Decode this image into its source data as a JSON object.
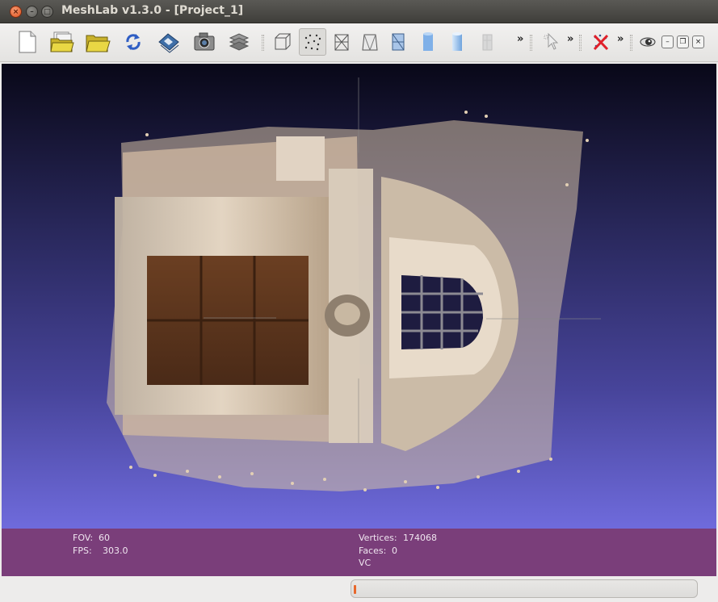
{
  "window": {
    "title": "MeshLab v1.3.0 - [Project_1]"
  },
  "window_controls": {
    "close": "×",
    "minimize": "–",
    "maximize": "□"
  },
  "toolbar": {
    "buttons": [
      {
        "name": "new-project",
        "icon": "new-file-icon"
      },
      {
        "name": "open-project",
        "icon": "open-stack-icon"
      },
      {
        "name": "import-mesh",
        "icon": "open-folder-icon"
      },
      {
        "name": "reload",
        "icon": "reload-icon"
      },
      {
        "name": "save",
        "icon": "save-icon"
      },
      {
        "name": "snapshot",
        "icon": "camera-icon"
      },
      {
        "name": "layers",
        "icon": "layers-icon"
      },
      {
        "name": "bounding-box",
        "icon": "bbox-icon"
      },
      {
        "name": "points",
        "icon": "points-icon",
        "active": true
      },
      {
        "name": "wireframe",
        "icon": "wireframe-icon"
      },
      {
        "name": "hidden-lines",
        "icon": "hidden-lines-icon"
      },
      {
        "name": "flat-lines",
        "icon": "flat-lines-icon"
      },
      {
        "name": "flat",
        "icon": "flat-icon"
      },
      {
        "name": "smooth",
        "icon": "smooth-icon"
      },
      {
        "name": "texture",
        "icon": "texture-icon"
      }
    ],
    "more_glyph": "»",
    "edit_tool": "select-icon",
    "delete_tool": "delete-vertices-icon",
    "render_tool": "eye-icon"
  },
  "mdi_controls": {
    "minimize": "–",
    "restore": "❐",
    "close": "×"
  },
  "info_panel": {
    "fov_label": "FOV:",
    "fov_value": "60",
    "fps_label": "FPS:",
    "fps_value": "303.0",
    "vertices_label": "Vertices:",
    "vertices_value": "174068",
    "faces_label": "Faces:",
    "faces_value": "0",
    "mode_text": "VC"
  },
  "status": {
    "progress_percent": 1
  },
  "colors": {
    "info_panel_bg": "#7a3e7a",
    "viewport_top": "#090818",
    "viewport_bottom": "#6f6bdc",
    "progress_fill": "#e8672b"
  }
}
